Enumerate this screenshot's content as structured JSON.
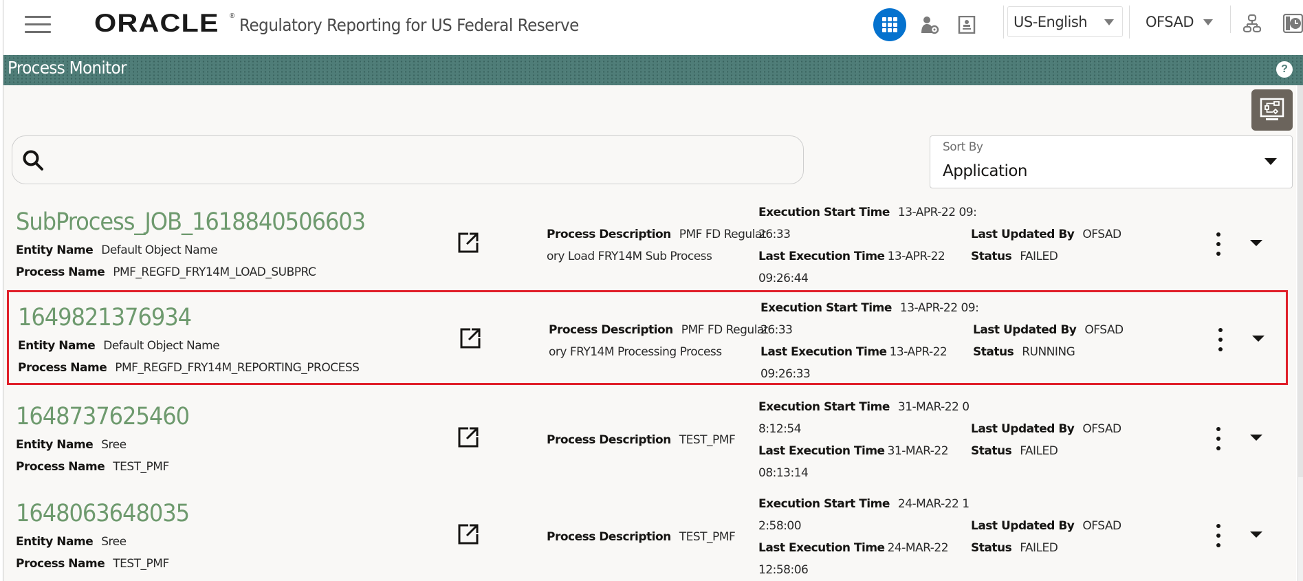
{
  "header": {
    "brand": "ORACLE",
    "app_title": "Regulatory Reporting for US Federal Reserve",
    "language": "US-English",
    "user": "OFSAD",
    "icons": [
      "hamburger-menu-icon",
      "app-grid-icon",
      "admin-settings-icon",
      "profile-card-icon",
      "hierarchy-icon",
      "clock-icon"
    ]
  },
  "band": {
    "title": "Process Monitor",
    "help": "?"
  },
  "search": {
    "value": "",
    "placeholder": ""
  },
  "sort": {
    "label": "Sort By",
    "value": "Application"
  },
  "labels": {
    "entity_name": "Entity Name",
    "process_name": "Process Name",
    "process_description": "Process Description",
    "execution_start_time": "Execution Start Time",
    "last_execution_time": "Last Execution Time",
    "last_updated_by": "Last Updated By",
    "status": "Status"
  },
  "processes": [
    {
      "title": "SubProcess_JOB_1618840506603",
      "entity_name": "Default Object Name",
      "process_name": "PMF_REGFD_FRY14M_LOAD_SUBPRC",
      "description_line1": "PMF FD Regulat",
      "description_line2": "ory Load FRY14M Sub Process",
      "exec_start_line1": "13-APR-22 09:",
      "exec_start_line2": "26:33",
      "last_exec_line1": "13-APR-22",
      "last_exec_line2": "09:26:44",
      "last_updated_by": "OFSAD",
      "status": "FAILED",
      "highlighted": false
    },
    {
      "title": "1649821376934",
      "entity_name": "Default Object Name",
      "process_name": "PMF_REGFD_FRY14M_REPORTING_PROCESS",
      "description_line1": "PMF FD Regulat",
      "description_line2": "ory FRY14M Processing Process",
      "exec_start_line1": "13-APR-22 09:",
      "exec_start_line2": "26:33",
      "last_exec_line1": "13-APR-22",
      "last_exec_line2": "09:26:33",
      "last_updated_by": "OFSAD",
      "status": "RUNNING",
      "highlighted": true
    },
    {
      "title": "1648737625460",
      "entity_name": "Sree",
      "process_name": "TEST_PMF",
      "description_line1": "TEST_PMF",
      "description_line2": "",
      "exec_start_line1": "31-MAR-22 0",
      "exec_start_line2": "8:12:54",
      "last_exec_line1": "31-MAR-22",
      "last_exec_line2": "08:13:14",
      "last_updated_by": "OFSAD",
      "status": "FAILED",
      "highlighted": false
    },
    {
      "title": "1648063648035",
      "entity_name": "Sree",
      "process_name": "TEST_PMF",
      "description_line1": "TEST_PMF",
      "description_line2": "",
      "exec_start_line1": "24-MAR-22 1",
      "exec_start_line2": "2:58:00",
      "last_exec_line1": "24-MAR-22",
      "last_exec_line2": "12:58:06",
      "last_updated_by": "OFSAD",
      "status": "FAILED",
      "highlighted": false
    }
  ],
  "colors": {
    "accent_blue": "#0572ce",
    "band_teal": "#4f7d78",
    "title_green": "#6e9a6e",
    "highlight_red": "#e0202a",
    "toolbar_button": "#6b645c"
  }
}
